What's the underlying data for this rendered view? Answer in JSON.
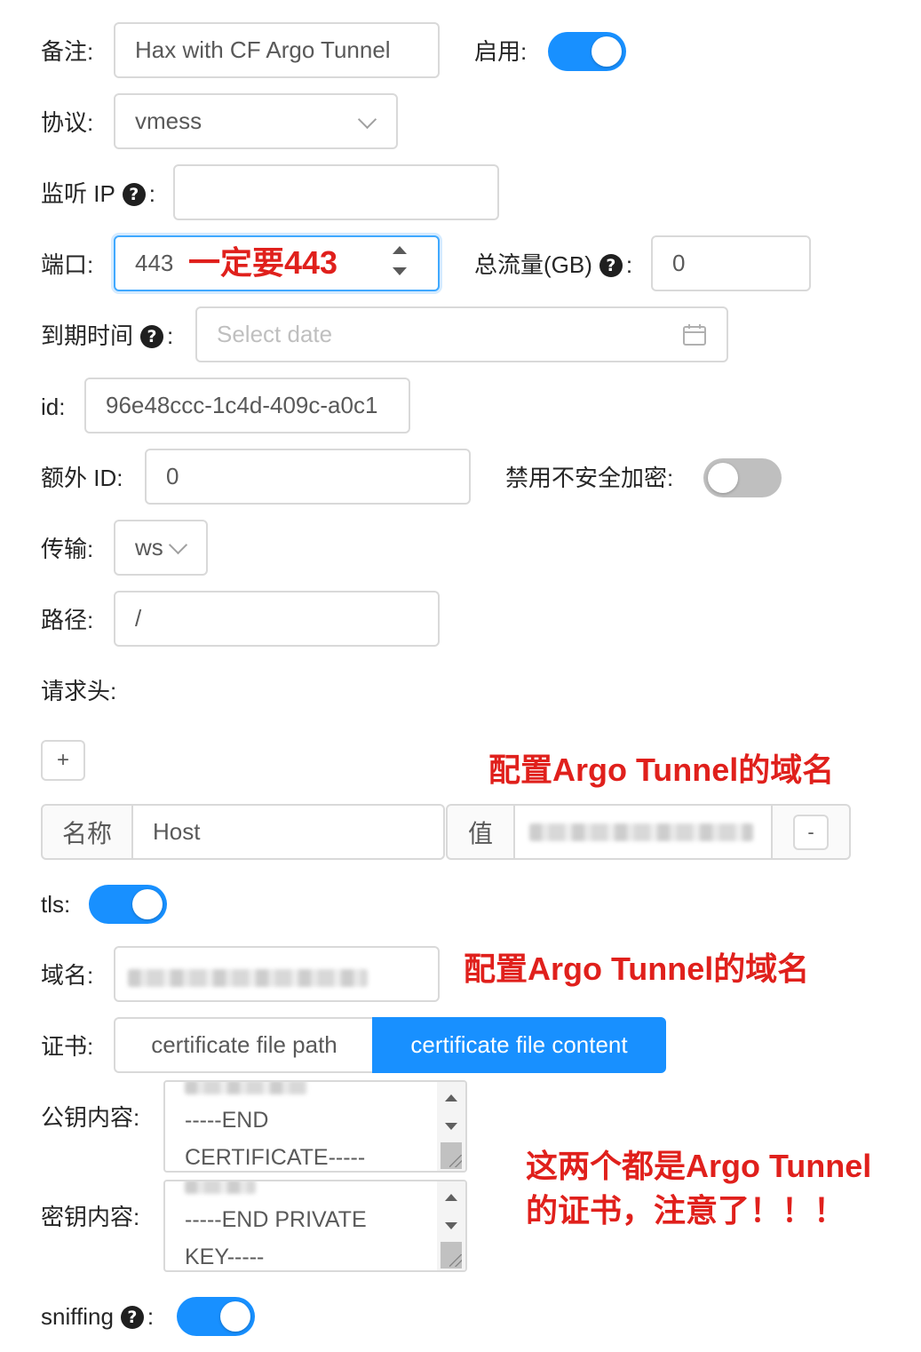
{
  "form": {
    "remark": {
      "label": "备注:",
      "value": "Hax with CF Argo Tunnel"
    },
    "enable": {
      "label": "启用:",
      "on": true
    },
    "protocol": {
      "label": "协议:",
      "value": "vmess"
    },
    "listen_ip": {
      "label": "监听 IP",
      "value": ""
    },
    "port": {
      "label": "端口:",
      "value": "443"
    },
    "total_traffic": {
      "label": "总流量(GB)",
      "value": "0"
    },
    "expiry": {
      "label": "到期时间",
      "placeholder": "Select date"
    },
    "id": {
      "label": "id:",
      "value": "96e48ccc-1c4d-409c-a0c1"
    },
    "alter_id": {
      "label": "额外 ID:",
      "value": "0"
    },
    "disable_insecure": {
      "label": "禁用不安全加密:",
      "on": false
    },
    "transport": {
      "label": "传输:",
      "value": "ws"
    },
    "path": {
      "label": "路径:",
      "value": "/"
    },
    "headers": {
      "label": "请求头:",
      "add_button": "+",
      "name_addon": "名称",
      "name_value": "Host",
      "value_addon": "值",
      "remove_button": "-"
    },
    "tls": {
      "label": "tls:",
      "on": true
    },
    "domain": {
      "label": "域名:"
    },
    "certificate": {
      "label": "证书:",
      "options": [
        "certificate file path",
        "certificate file content"
      ],
      "selected": "certificate file content"
    },
    "public_key": {
      "label": "公钥内容:",
      "text": "-----END\nCERTIFICATE-----"
    },
    "private_key": {
      "label": "密钥内容:",
      "text": "-----END PRIVATE\nKEY-----"
    },
    "sniffing": {
      "label": "sniffing",
      "on": true
    },
    "colon": ":"
  },
  "annotations": {
    "port_note": "一定要443",
    "host_note": "配置Argo Tunnel的域名",
    "domain_note": "配置Argo Tunnel的域名",
    "cert_note_line1": "这两个都是Argo Tunnel",
    "cert_note_line2": "的证书，注意了！！！"
  },
  "colors": {
    "primary": "#1890ff",
    "annotation_red": "#e0201c",
    "border": "#d9d9d9"
  }
}
